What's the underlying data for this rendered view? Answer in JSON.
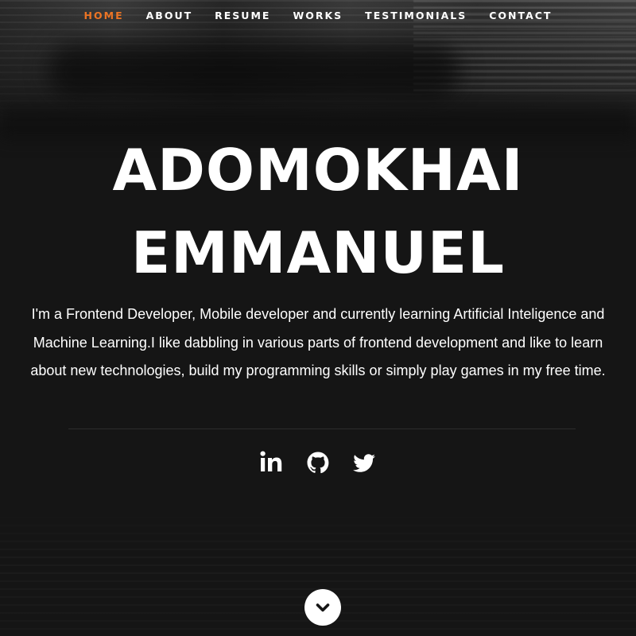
{
  "nav": {
    "items": [
      {
        "label": "HOME",
        "active": true
      },
      {
        "label": "ABOUT",
        "active": false
      },
      {
        "label": "RESUME",
        "active": false
      },
      {
        "label": "WORKS",
        "active": false
      },
      {
        "label": "TESTIMONIALS",
        "active": false
      },
      {
        "label": "CONTACT",
        "active": false
      }
    ],
    "active_color": "#ec7424"
  },
  "hero": {
    "name_line1": "ADOMOKHAI",
    "name_line2": "EMMANUEL",
    "description": "I'm a Frontend Developer, Mobile developer and currently learning Artificial Inteligence and Machine Learning.I like dabbling in various parts of frontend development and like to learn about new technologies, build my programming skills or simply play games in my free time."
  },
  "social": [
    {
      "icon": "linkedin-icon"
    },
    {
      "icon": "github-icon"
    },
    {
      "icon": "twitter-icon"
    }
  ],
  "scroll_down": {
    "icon": "chevron-down-icon"
  }
}
